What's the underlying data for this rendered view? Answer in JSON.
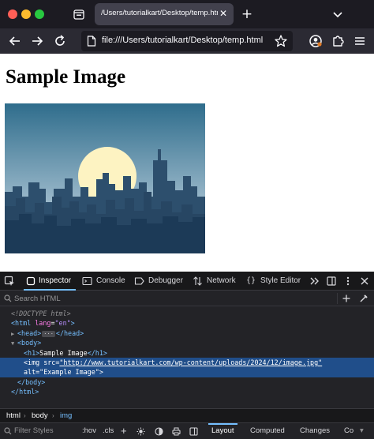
{
  "browser": {
    "tab": {
      "title": "/Users/tutorialkart/Desktop/temp.html",
      "close_glyph": "✕"
    },
    "new_tab_glyph": "+",
    "url": "file:///Users/tutorialkart/Desktop/temp.html",
    "icons": [
      "tab-overview-icon",
      "tab-list-icon",
      "back-icon",
      "forward-icon",
      "reload-icon",
      "page-icon",
      "bookmark-star-icon",
      "account-icon",
      "extensions-icon",
      "menu-icon"
    ]
  },
  "page": {
    "heading": "Sample Image",
    "image": {
      "alt": "Example Image",
      "colors": {
        "sky_top": "#2f6d8c",
        "sky_bottom": "#aac3d3",
        "sun": "#fdf3c2",
        "city_back": "#2d4f6d",
        "city_front": "#1c3a57"
      }
    }
  },
  "devtools": {
    "tabs": [
      "Inspector",
      "Console",
      "Debugger",
      "Network",
      "Style Editor"
    ],
    "active_tab": "Inspector",
    "search_placeholder": "Search HTML",
    "markup": {
      "doctype": "<!DOCTYPE html>",
      "html_open": "<html",
      "lang_attr": "lang",
      "lang_val": "\"en\"",
      "head_open": "<head>",
      "head_close": "</head>",
      "ellipsis": "···",
      "body_open": "<body>",
      "h1_open": "<h1>",
      "h1_text": "Sample Image",
      "h1_close": "</h1>",
      "img_open": "<img",
      "src_attr": "src=",
      "src_val": "\"http://www.tutorialkart.com/wp-content/uploads/2024/12/image.jpg\"",
      "alt_attr": "alt=",
      "alt_val": "\"Example Image\"",
      "img_end": ">",
      "body_close": "</body>",
      "html_close": "</html>",
      "gt": ">"
    },
    "breadcrumbs": [
      "html",
      "body",
      "img"
    ],
    "rules_bar": {
      "filter_placeholder": "Filter Styles",
      "hov": ":hov",
      "cls": ".cls",
      "add": "+",
      "tabs": [
        "Layout",
        "Computed",
        "Changes",
        "Co"
      ],
      "active_tab": "Layout"
    },
    "colors": {
      "accent": "#75bfff",
      "selection": "#204e8a",
      "tag": "#75bfff",
      "attr": "#ff7de9",
      "value": "#b98eff"
    }
  }
}
